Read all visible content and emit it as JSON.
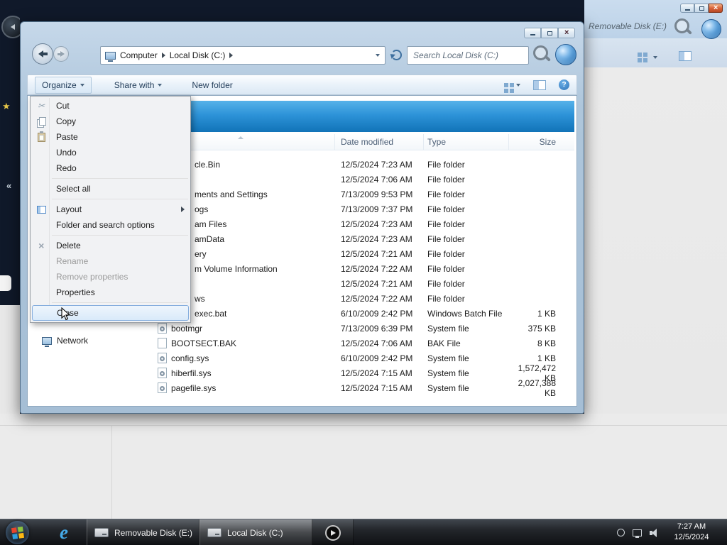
{
  "front_window": {
    "breadcrumb": {
      "computer": "Computer",
      "drive": "Local Disk (C:)"
    },
    "search": {
      "placeholder": "Search Local Disk (C:)"
    },
    "toolbar": {
      "organize": "Organize",
      "share_with": "Share with",
      "new_folder": "New folder",
      "right_icons": [
        "views",
        "preview-pane",
        "help"
      ]
    },
    "menu": {
      "items": [
        {
          "label": "Cut",
          "icon": "scissors"
        },
        {
          "label": "Copy",
          "icon": "copy-pages"
        },
        {
          "label": "Paste",
          "icon": "clipboard"
        },
        {
          "label": "Undo"
        },
        {
          "label": "Redo"
        },
        {
          "label": "Select all"
        },
        {
          "label": "Layout",
          "icon": "layout",
          "has_submenu": true
        },
        {
          "label": "Folder and search options"
        },
        {
          "label": "Delete",
          "icon": "x-mark"
        },
        {
          "label": "Rename",
          "disabled": true
        },
        {
          "label": "Remove properties",
          "disabled": true
        },
        {
          "label": "Properties"
        },
        {
          "label": "Close",
          "highlighted": true
        }
      ]
    },
    "columns": {
      "date": "Date modified",
      "type": "Type",
      "size": "Size"
    },
    "rows": [
      {
        "name": "cle.Bin",
        "date": "12/5/2024 7:23 AM",
        "type": "File folder",
        "size": ""
      },
      {
        "name": "",
        "date": "12/5/2024 7:06 AM",
        "type": "File folder",
        "size": ""
      },
      {
        "name": "ments and Settings",
        "date": "7/13/2009 9:53 PM",
        "type": "File folder",
        "size": ""
      },
      {
        "name": "ogs",
        "date": "7/13/2009 7:37 PM",
        "type": "File folder",
        "size": ""
      },
      {
        "name": "am Files",
        "date": "12/5/2024 7:23 AM",
        "type": "File folder",
        "size": ""
      },
      {
        "name": "amData",
        "date": "12/5/2024 7:23 AM",
        "type": "File folder",
        "size": ""
      },
      {
        "name": "ery",
        "date": "12/5/2024 7:21 AM",
        "type": "File folder",
        "size": ""
      },
      {
        "name": "m Volume Information",
        "date": "12/5/2024 7:22 AM",
        "type": "File folder",
        "size": ""
      },
      {
        "name": "",
        "date": "12/5/2024 7:21 AM",
        "type": "File folder",
        "size": ""
      },
      {
        "name": "ws",
        "date": "12/5/2024 7:22 AM",
        "type": "File folder",
        "size": ""
      },
      {
        "name": "exec.bat",
        "date": "6/10/2009 2:42 PM",
        "type": "Windows Batch File",
        "size": "1 KB"
      },
      {
        "name": "bootmgr",
        "date": "7/13/2009 6:39 PM",
        "type": "System file",
        "size": "375 KB"
      },
      {
        "name": "BOOTSECT.BAK",
        "date": "12/5/2024 7:06 AM",
        "type": "BAK File",
        "size": "8 KB"
      },
      {
        "name": "config.sys",
        "date": "6/10/2009 2:42 PM",
        "type": "System file",
        "size": "1 KB"
      },
      {
        "name": "hiberfil.sys",
        "date": "12/5/2024 7:15 AM",
        "type": "System file",
        "size": "1,572,472 KB"
      },
      {
        "name": "pagefile.sys",
        "date": "12/5/2024 7:15 AM",
        "type": "System file",
        "size": "2,027,388 KB"
      }
    ],
    "nav": {
      "network": "Network"
    }
  },
  "background_window": {
    "search_text": "Removable Disk (E:)",
    "icons": [
      "search-magnifier",
      "globe-sphere",
      "views",
      "preview-pane"
    ]
  },
  "taskbar": {
    "buttons": [
      {
        "label": "Removable Disk (E:)"
      },
      {
        "label": "Local Disk (C:)",
        "active": true
      }
    ],
    "tray_icons": [
      "status-circle",
      "network",
      "volume"
    ],
    "clock": {
      "time": "7:27 AM",
      "date": "12/5/2024"
    }
  },
  "colors": {
    "band_blue": "#2d93d8",
    "menu_highlight_border": "#86aede",
    "taskbar_dark": "#23262b"
  }
}
